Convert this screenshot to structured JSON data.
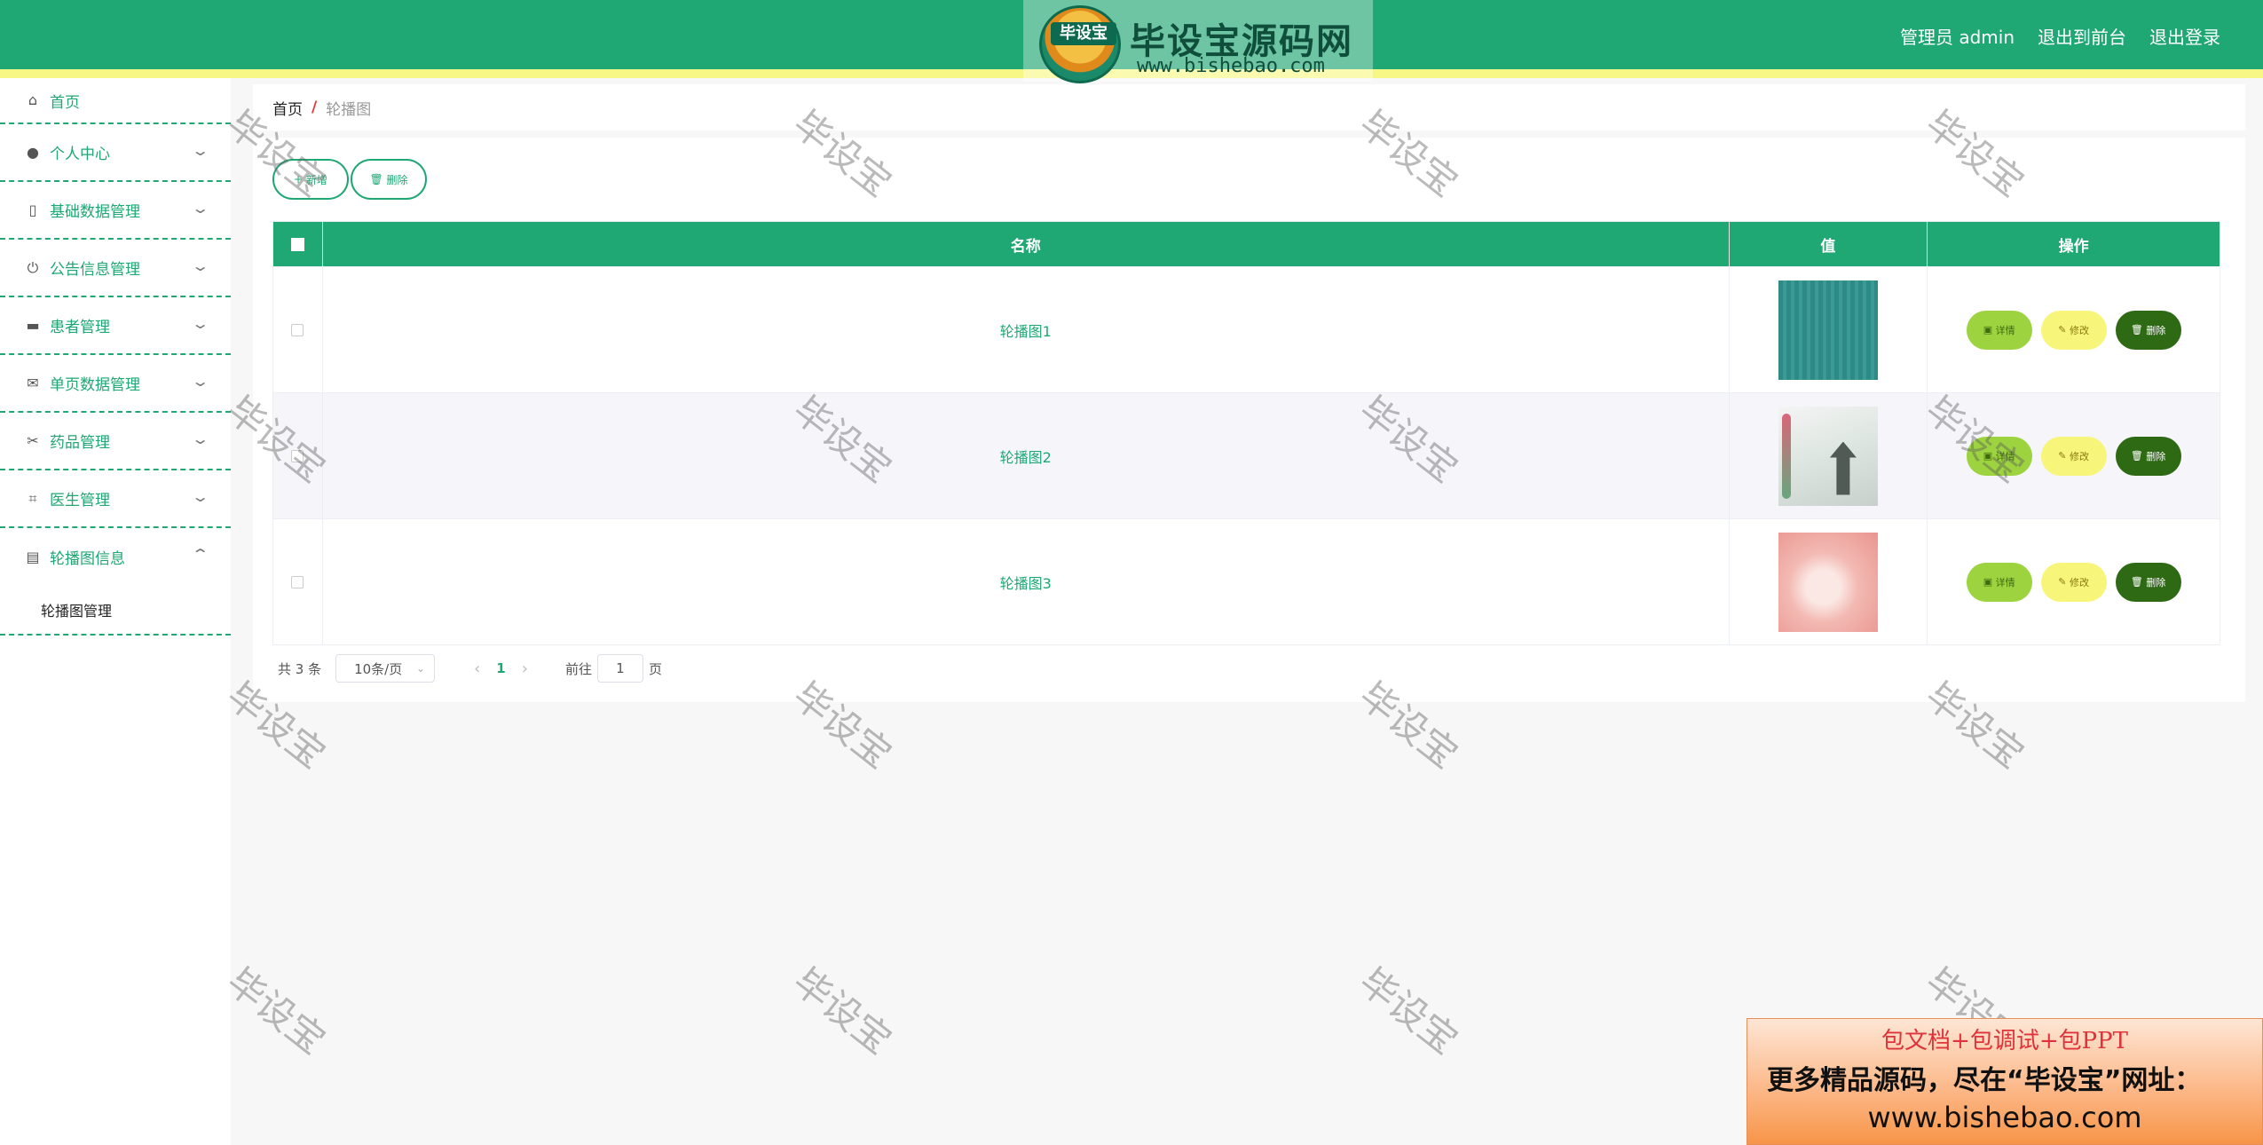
{
  "header": {
    "user_label": "管理员 admin",
    "front_link": "退出到前台",
    "logout_link": "退出登录",
    "accent_color": "#1fa774"
  },
  "logo_watermark": {
    "badge": "毕设宝",
    "title": "毕设宝源码网",
    "url": "www.bishebao.com"
  },
  "sidebar": {
    "items": [
      {
        "label": "首页",
        "icon": "home-icon"
      },
      {
        "label": "个人中心",
        "icon": "user-icon"
      },
      {
        "label": "基础数据管理",
        "icon": "microphone-icon"
      },
      {
        "label": "公告信息管理",
        "icon": "power-icon"
      },
      {
        "label": "患者管理",
        "icon": "monitor-icon"
      },
      {
        "label": "单页数据管理",
        "icon": "mail-icon"
      },
      {
        "label": "药品管理",
        "icon": "ticket-icon"
      },
      {
        "label": "医生管理",
        "icon": "crop-icon"
      },
      {
        "label": "轮播图信息",
        "icon": "clipboard-icon"
      }
    ],
    "sub_item": "轮播图管理"
  },
  "breadcrumb": {
    "home": "首页",
    "separator": "/",
    "current": "轮播图"
  },
  "toolbar": {
    "add_label": "新增",
    "delete_label": "删除"
  },
  "table": {
    "columns": [
      "名称",
      "值",
      "操作"
    ],
    "rows": [
      {
        "name": "轮播图1"
      },
      {
        "name": "轮播图2"
      },
      {
        "name": "轮播图3"
      }
    ],
    "actions": {
      "detail": "详情",
      "edit": "修改",
      "delete": "删除"
    }
  },
  "pagination": {
    "total": "共 3 条",
    "page_size": "10条/页",
    "current_page": "1",
    "goto_prefix": "前往",
    "goto_value": "1",
    "goto_suffix": "页"
  },
  "watermark_text": "毕设宝",
  "ad": {
    "line1": "包文档+包调试+包PPT",
    "line2": "更多精品源码，尽在“毕设宝”网址：",
    "line3": "www.bishebao.com"
  }
}
